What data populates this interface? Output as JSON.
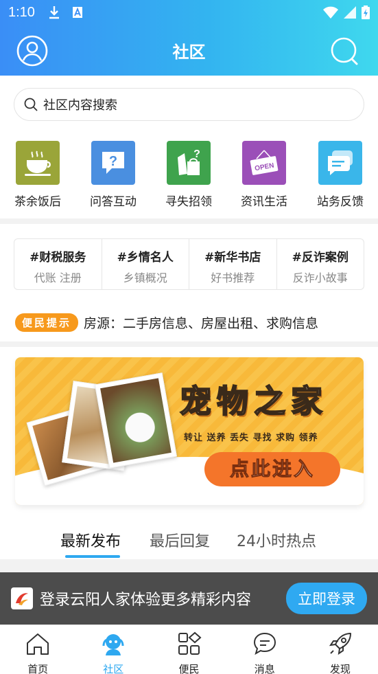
{
  "status_bar": {
    "time": "1:10"
  },
  "header": {
    "title": "社区"
  },
  "search": {
    "placeholder": "社区内容搜索"
  },
  "categories": [
    {
      "label": "茶余饭后",
      "icon": "teacup-icon",
      "color": "#9aa539"
    },
    {
      "label": "问答互动",
      "icon": "question-bubble-icon",
      "color": "#4a8fe0"
    },
    {
      "label": "寻失招领",
      "icon": "lost-found-icon",
      "color": "#3fa34d"
    },
    {
      "label": "资讯生活",
      "icon": "open-sign-icon",
      "color": "#9b4fb8"
    },
    {
      "label": "站务反馈",
      "icon": "chat-bubbles-icon",
      "color": "#3ab6ea"
    }
  ],
  "topics": [
    {
      "title": "#财税服务",
      "sub": "代账 注册"
    },
    {
      "title": "#乡情名人",
      "sub": "乡镇概况"
    },
    {
      "title": "#新华书店",
      "sub": "好书推荐"
    },
    {
      "title": "#反诈案例",
      "sub": "反诈小故事"
    }
  ],
  "notice": {
    "badge": "便民提示",
    "text": "房源：二手房信息、房屋出租、求购信息"
  },
  "banner": {
    "title": "宠物之家",
    "subtitle": "转让 送养  丢失 寻找  求购 领养",
    "cta": "点此进入"
  },
  "feed_tabs": [
    {
      "label": "最新发布",
      "active": true
    },
    {
      "label": "最后回复",
      "active": false
    },
    {
      "label": "24小时热点",
      "active": false
    }
  ],
  "login_bar": {
    "message": "登录云阳人家体验更多精彩内容",
    "button": "立即登录"
  },
  "tabbar": [
    {
      "label": "首页",
      "icon": "home-icon",
      "active": false
    },
    {
      "label": "社区",
      "icon": "community-icon",
      "active": true
    },
    {
      "label": "便民",
      "icon": "grid-icon",
      "active": false
    },
    {
      "label": "消息",
      "icon": "message-icon",
      "active": false
    },
    {
      "label": "发现",
      "icon": "rocket-icon",
      "active": false
    }
  ],
  "colors": {
    "accent": "#2ea8f0",
    "notice_badge": "#f7991c",
    "login_bar_bg": "#4c4c4c"
  }
}
